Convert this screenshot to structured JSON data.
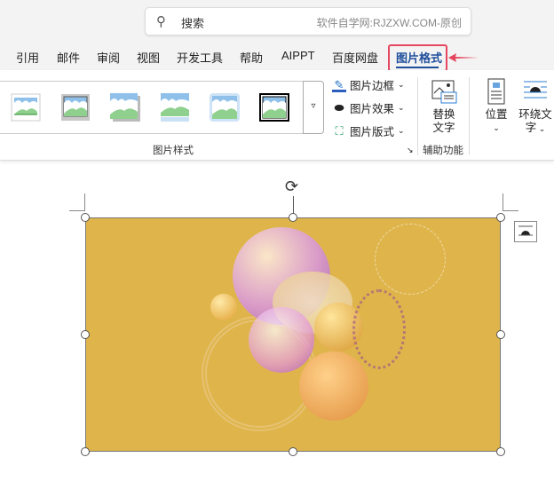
{
  "search": {
    "icon": "search-icon",
    "label": "搜索",
    "watermark": "软件自学网:RJZXW.COM-原创"
  },
  "tabs": [
    "引用",
    "邮件",
    "审阅",
    "视图",
    "开发工具",
    "帮助",
    "AIPPT",
    "百度网盘",
    "图片格式"
  ],
  "active_tab": "图片格式",
  "ribbon": {
    "picture_styles_group": "图片样式",
    "commands": {
      "border": "图片边框",
      "effects": "图片效果",
      "layout": "图片版式"
    },
    "accessibility_group": "辅助功能",
    "alt_text": [
      "替换",
      "文字"
    ],
    "position": "位置",
    "wrap_text": [
      "环绕文",
      "字"
    ]
  },
  "colors": {
    "accent": "#1f4e9c",
    "highlight": "#e5475f",
    "image_bg": "#dfb54b"
  }
}
